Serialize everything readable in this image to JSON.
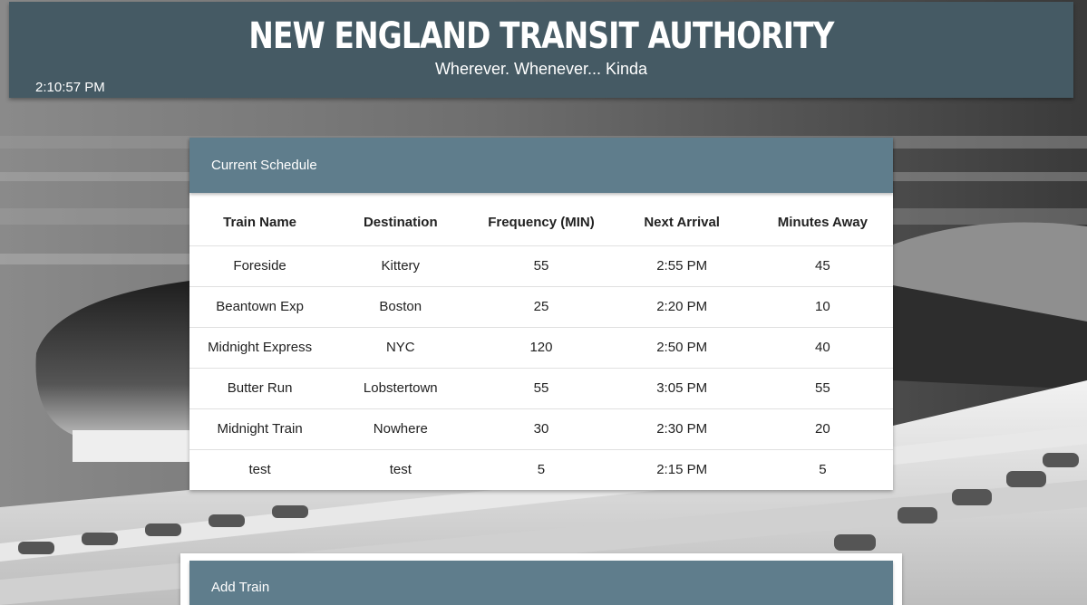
{
  "header": {
    "title": "NEW ENGLAND TRANSIT AUTHORITY",
    "tagline": "Wherever. Whenever... Kinda",
    "clock": "2:10:57 PM",
    "bg_color": "#455a64"
  },
  "schedule": {
    "title": "Current Schedule",
    "header_color": "#5f7d8c",
    "columns": [
      "Train Name",
      "Destination",
      "Frequency (MIN)",
      "Next Arrival",
      "Minutes Away"
    ],
    "rows": [
      [
        "Foreside",
        "Kittery",
        "55",
        "2:55 PM",
        "45"
      ],
      [
        "Beantown Exp",
        "Boston",
        "25",
        "2:20 PM",
        "10"
      ],
      [
        "Midnight Express",
        "NYC",
        "120",
        "2:50 PM",
        "40"
      ],
      [
        "Butter Run",
        "Lobstertown",
        "55",
        "3:05 PM",
        "55"
      ],
      [
        "Midnight Train",
        "Nowhere",
        "30",
        "2:30 PM",
        "20"
      ],
      [
        "test",
        "test",
        "5",
        "2:15 PM",
        "5"
      ]
    ]
  },
  "add_train": {
    "title": "Add Train"
  }
}
